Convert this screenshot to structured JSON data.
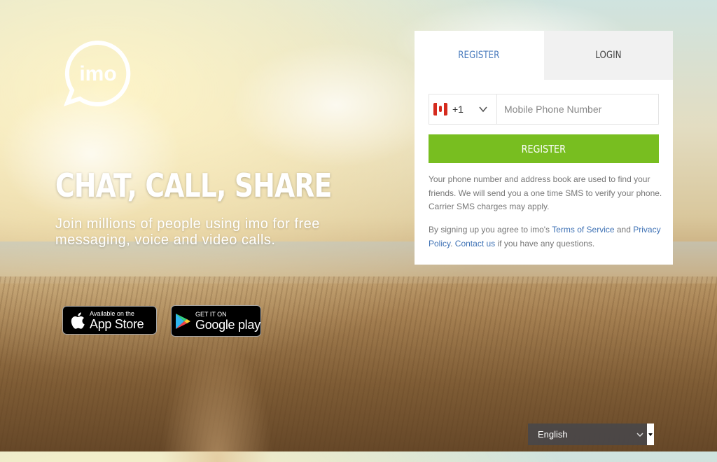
{
  "brand": {
    "logo_text": "imo",
    "logo_icon": "imo-chat-bubble-logo"
  },
  "hero": {
    "title": "CHAT, CALL, SHARE",
    "subtitle": "Join millions of people using imo for free messaging, voice and video calls."
  },
  "badges": {
    "appstore_small": "Available on the",
    "appstore_big": "App Store",
    "appstore_icon": "apple-icon",
    "googleplay_small": "GET IT ON",
    "googleplay_big": "Google play",
    "googleplay_icon": "google-play-icon"
  },
  "auth": {
    "tabs": [
      {
        "label": "REGISTER",
        "active": true
      },
      {
        "label": "LOGIN",
        "active": false
      }
    ],
    "country_code": "+1",
    "country_flag": "canada-flag-icon",
    "phone_placeholder": "Mobile Phone Number",
    "register_label": "REGISTER",
    "info_text": "Your phone number and address book are used to find your friends. We will send you a one time SMS to verify your phone. Carrier SMS charges may apply.",
    "terms_prefix": "By signing up you agree to imo's ",
    "terms_link": "Terms of Service",
    "terms_and": " and ",
    "privacy_link": "Privacy Policy",
    "privacy_sep": ". ",
    "contact_link": "Contact us",
    "terms_suffix": " if you have any questions."
  },
  "language": {
    "selected": "English"
  },
  "colors": {
    "accent_green": "#78be20",
    "link_blue": "#3f72b5",
    "tab_active_text": "#4a7bbd"
  }
}
